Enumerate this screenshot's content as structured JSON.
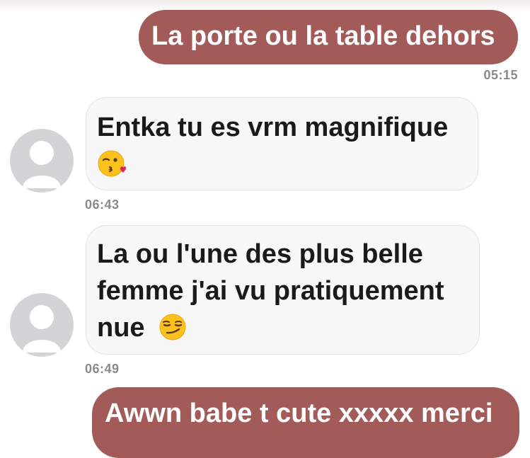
{
  "messages": [
    {
      "direction": "outgoing",
      "text": "La porte ou la table dehors",
      "time": "05:15"
    },
    {
      "direction": "incoming",
      "text": "Entka tu es vrm magnifique",
      "emoji": "kissing-wink-heart-emoji",
      "time": "06:43"
    },
    {
      "direction": "incoming",
      "text_lines": [
        "La ou l'une des plus belle",
        "femme j'ai vu pratiquement",
        "nue"
      ],
      "emoji": "smirking-face-emoji",
      "time": "06:49"
    },
    {
      "direction": "outgoing",
      "text": "Awwn babe t cute xxxxx merci"
    }
  ],
  "colors": {
    "outgoing_bubble": "#a35b5a",
    "incoming_bubble": "#f7f7f7",
    "timestamp": "#8a8a8a",
    "avatar": "#d4d4d6"
  }
}
